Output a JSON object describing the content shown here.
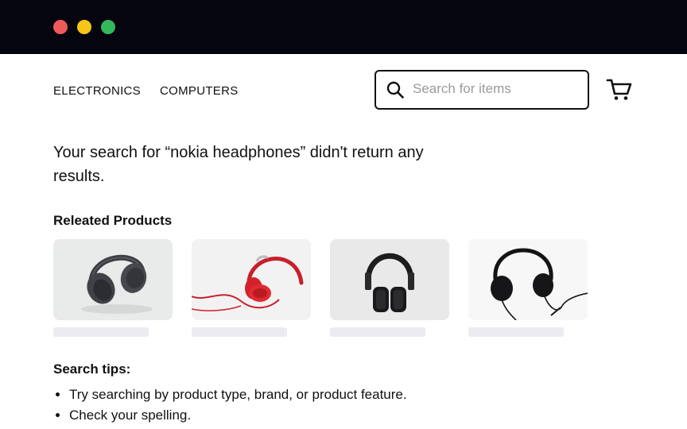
{
  "window": {
    "controls": [
      "close",
      "minimize",
      "maximize"
    ]
  },
  "nav": {
    "links": [
      "ELECTRONICS",
      "COMPUTERS"
    ]
  },
  "search": {
    "value": "",
    "placeholder": "Search for items",
    "icon": "search-icon"
  },
  "cart": {
    "icon": "cart-icon"
  },
  "results": {
    "message": "Your search for “nokia headphones” didn't return any results."
  },
  "related": {
    "title": "Releated Products",
    "products": [
      {
        "image": "grey over-ear headphones"
      },
      {
        "image": "red on-ear headphones"
      },
      {
        "image": "black on-ear headphones"
      },
      {
        "image": "black corded headphones"
      }
    ]
  },
  "tips": {
    "title": "Search tips:",
    "items": [
      "Try searching by product type, brand, or product feature.",
      "Check your spelling."
    ]
  },
  "colors": {
    "titlebar": "#05050f",
    "close": "#ee5a5a",
    "minimize": "#f5c518",
    "maximize": "#34b85a"
  }
}
